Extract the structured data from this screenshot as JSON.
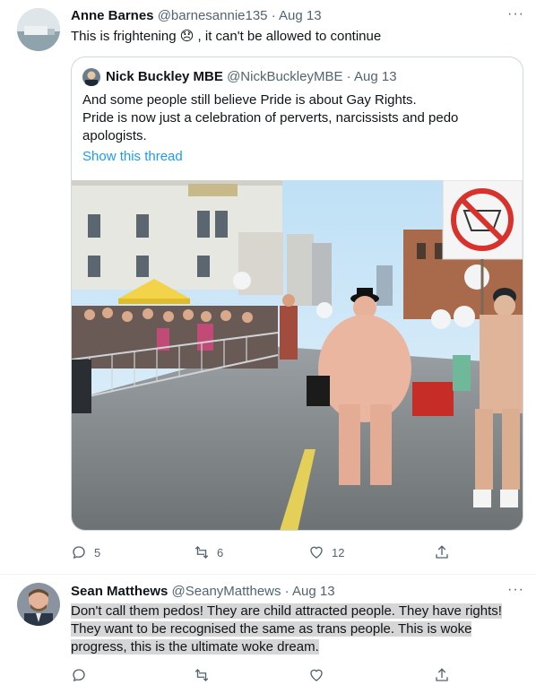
{
  "tweet1": {
    "name": "Anne Barnes",
    "handle": "@barnesannie135",
    "dot": "·",
    "date": "Aug 13",
    "text_before": "This is frightening ",
    "emoji": "😞",
    "text_after": " , it can't be allowed to continue",
    "more": "···"
  },
  "quote": {
    "name": "Nick Buckley MBE",
    "handle": "@NickBuckleyMBE",
    "dot": "·",
    "date": "Aug 13",
    "line1": "And some people still believe Pride is about Gay Rights.",
    "line2": "Pride is now just a celebration of perverts, narcissists and pedo",
    "line3": "apologists.",
    "show_thread": "Show this thread"
  },
  "tweet1_actions": {
    "replies": "5",
    "retweets": "6",
    "likes": "12"
  },
  "tweet2": {
    "name": "Sean Matthews",
    "handle": "@SeanyMatthews",
    "dot": "·",
    "date": "Aug 13",
    "more": "···",
    "line1": "Don't call them pedos! They are child attracted people. They have rights!",
    "line2": "They want to be recognised the same as trans people. This is woke",
    "line3": "progress, this is the ultimate woke dream."
  },
  "colors": {
    "accent": "#1d9bf0",
    "muted": "#536471",
    "highlight": "#d6d6d6"
  }
}
